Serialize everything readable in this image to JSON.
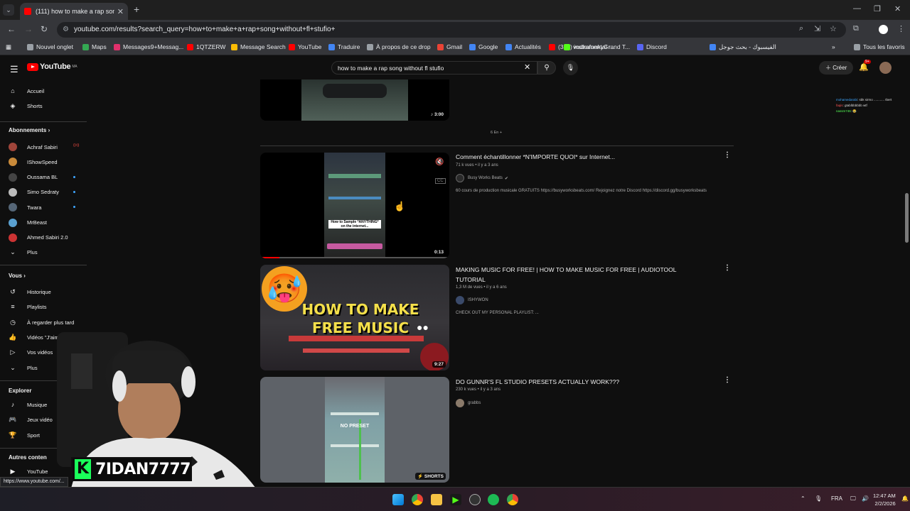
{
  "browser": {
    "tab_title": "(111) how to make a rap song ...",
    "tab_close": "✕",
    "new_tab": "+",
    "url": "youtube.com/results?search_query=how+to+make+a+rap+song+without+fl+stufio+",
    "bookmarks": [
      {
        "label": "Nouvel onglet",
        "color": "#9aa0a6"
      },
      {
        "label": "Maps",
        "color": "#34a853"
      },
      {
        "label": "Messages9+Messag...",
        "color": "#e1306c"
      },
      {
        "label": "1QTZERW",
        "color": "#ff0000"
      },
      {
        "label": "Message Search",
        "color": "#fbbc05"
      },
      {
        "label": "YouTube",
        "color": "#ff0000"
      },
      {
        "label": "Traduire",
        "color": "#4285f4"
      },
      {
        "label": "À propos de ce drop",
        "color": "#9aa0a6"
      },
      {
        "label": "Gmail",
        "color": "#ea4335"
      },
      {
        "label": "Google",
        "color": "#4285f4"
      },
      {
        "label": "Actualités",
        "color": "#4285f4"
      },
      {
        "label": "(321) instrumental r...",
        "color": "#ff0000"
      },
      {
        "label": "vodkafunkyGrand T...",
        "color": "#53fc18"
      },
      {
        "label": "Discord",
        "color": "#5865f2"
      },
      {
        "label": "الفيسبوك - بحث جوجل",
        "color": "#4285f4"
      },
      {
        "label": "Tous les favoris",
        "color": "#9aa0a6"
      }
    ]
  },
  "youtube": {
    "logo_text": "YouTube",
    "logo_region": "MA",
    "search_value": "how to make a rap song without fl stufio",
    "create_label": "Créer",
    "notif_count": "9+"
  },
  "sidebar": {
    "top": [
      {
        "label": "Accueil",
        "icon": "home-icon",
        "glyph": "⌂"
      },
      {
        "label": "Shorts",
        "icon": "shorts-icon",
        "glyph": "◈"
      }
    ],
    "subs_title": "Abonnements",
    "subs": [
      {
        "label": "Achraf Sabiri",
        "color": "#a0453a",
        "flag": "live"
      },
      {
        "label": "IShowSpeed",
        "color": "#c98a3a",
        "flag": ""
      },
      {
        "label": "Oussama BL",
        "color": "#444",
        "flag": "dot"
      },
      {
        "label": "Simo Sedraty",
        "color": "#bbb",
        "flag": "dot"
      },
      {
        "label": "Twara",
        "color": "#556677",
        "flag": "dot"
      },
      {
        "label": "MrBeast",
        "color": "#5aa0d0",
        "flag": ""
      },
      {
        "label": "Ahmed Sabiri 2.0",
        "color": "#cc3333",
        "flag": ""
      }
    ],
    "subs_more": "Plus",
    "you_title": "Vous",
    "you": [
      {
        "label": "Historique",
        "icon": "history-icon",
        "glyph": "↺"
      },
      {
        "label": "Playlists",
        "icon": "playlists-icon",
        "glyph": "≡"
      },
      {
        "label": "À regarder plus tard",
        "icon": "watch-later-icon",
        "glyph": "◷"
      },
      {
        "label": "Vidéos \"J'aime\"",
        "icon": "like-icon",
        "glyph": "👍"
      },
      {
        "label": "Vos vidéos",
        "icon": "your-videos-icon",
        "glyph": "▷"
      }
    ],
    "you_more": "Plus",
    "explore_title": "Explorer",
    "explore": [
      {
        "label": "Musique",
        "icon": "music-icon",
        "glyph": "♪"
      },
      {
        "label": "Jeux vidéo",
        "icon": "gaming-icon",
        "glyph": "🎮"
      },
      {
        "label": "Sport",
        "icon": "trophy-icon",
        "glyph": "🏆"
      }
    ],
    "other_title": "Autres conten",
    "other_item": "YouTube"
  },
  "results": {
    "prev_duration": "3:00",
    "more_label": "6 En +",
    "videos": [
      {
        "title": "Comment échantillonner *N'IMPORTE QUOI* sur Internet...",
        "meta": "71 k vues • il y a 3 ans",
        "channel": "Busy Works Beats",
        "verified": "✔",
        "desc": "60 cours de production musicale GRATUITS https://busyworksbeats.com/ Rejoignez notre Discord https://discord.gg/busyworksbeats",
        "duration": "0:13",
        "thumb_caption": "How to Sample *ANYTHING* on the internet..."
      },
      {
        "title": "MAKING MUSIC FOR FREE! | HOW TO MAKE MUSIC FOR FREE | AUDIOTOOL TUTORIAL",
        "meta": "1,3 M de vues • il y a 6 ans",
        "channel": "ISHYWON",
        "desc": "CHECK OUT MY PERSONAL PLAYLIST: ...",
        "duration": "9:27",
        "thumb_caption": "HOW TO MAKE FREE MUSIC"
      },
      {
        "title": "DO GUNNR'S FL STUDIO PRESETS ACTUALLY WORK???",
        "meta": "230 k vues • il y a 3 ans",
        "channel": "grabbs",
        "desc": "",
        "duration": "SHORTS",
        "thumb_caption": "NO PRESET"
      }
    ]
  },
  "chat": {
    "lines": [
      {
        "user": "mohamedarabi",
        "text": "sbk sirmo ............ Ibert",
        "color": "#3ea6ff"
      },
      {
        "user": "faqis",
        "text": "gtablbbbbbb wtf",
        "color": "#ff5555"
      },
      {
        "user": "nassm746",
        "text": "😂",
        "color": "#55ff55"
      }
    ]
  },
  "stream_overlay": {
    "name": "7IDAN7777",
    "logo": "K"
  },
  "status_url": "https://www.youtube.com/...",
  "taskbar": {
    "lang": "FRA",
    "time": "12:47 AM",
    "date": "2/2/2026"
  }
}
